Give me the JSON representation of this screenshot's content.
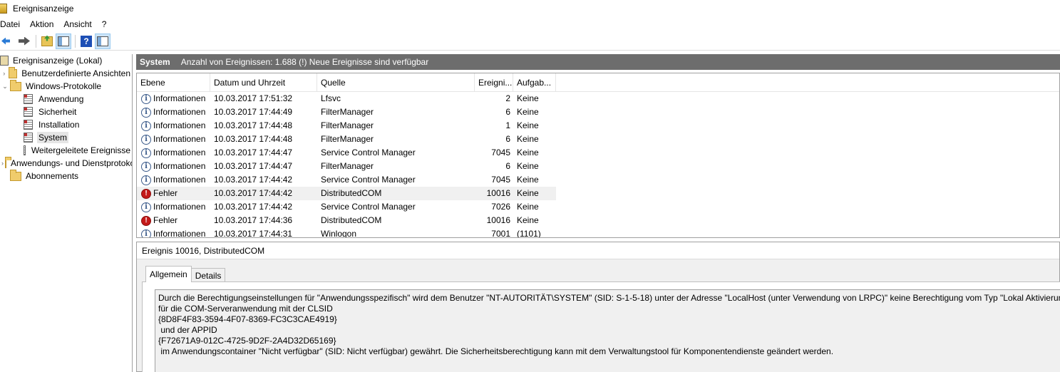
{
  "window": {
    "title": "Ereignisanzeige"
  },
  "menu": [
    "Datei",
    "Aktion",
    "Ansicht",
    "?"
  ],
  "toolbar": {
    "buttons": [
      "back-icon",
      "forward-icon",
      "up-folder-icon",
      "show-hide-pane-icon",
      "help-icon",
      "action-pane-icon"
    ]
  },
  "tree": [
    {
      "label": "Ereignisanzeige (Lokal)",
      "level": 0,
      "icon": "event-viewer-icon",
      "expander": ""
    },
    {
      "label": "Benutzerdefinierte Ansichten",
      "level": 1,
      "icon": "folder-icon",
      "expander": "›"
    },
    {
      "label": "Windows-Protokolle",
      "level": 1,
      "icon": "folder-icon",
      "expander": "⌄"
    },
    {
      "label": "Anwendung",
      "level": 2,
      "icon": "log-icon"
    },
    {
      "label": "Sicherheit",
      "level": 2,
      "icon": "log-icon"
    },
    {
      "label": "Installation",
      "level": 2,
      "icon": "log-icon"
    },
    {
      "label": "System",
      "level": 2,
      "icon": "log-icon",
      "selected": true
    },
    {
      "label": "Weitergeleitete Ereignisse",
      "level": 2,
      "icon": "log-icon-plain"
    },
    {
      "label": "Anwendungs- und Dienstprotokolle",
      "level": 1,
      "icon": "folder-icon",
      "expander": "›"
    },
    {
      "label": "Abonnements",
      "level": 1,
      "icon": "folder-icon",
      "expander": ""
    }
  ],
  "header": {
    "log_name": "System",
    "count_text": "Anzahl von Ereignissen: 1.688 (!) Neue Ereignisse sind verfügbar"
  },
  "columns": [
    "Ebene",
    "Datum und Uhrzeit",
    "Quelle",
    "Ereigni...",
    "Aufgab..."
  ],
  "events": [
    {
      "level": "Informationen",
      "type": "info",
      "date": "10.03.2017 17:51:32",
      "source": "Lfsvc",
      "id": "2",
      "task": "Keine"
    },
    {
      "level": "Informationen",
      "type": "info",
      "date": "10.03.2017 17:44:49",
      "source": "FilterManager",
      "id": "6",
      "task": "Keine"
    },
    {
      "level": "Informationen",
      "type": "info",
      "date": "10.03.2017 17:44:48",
      "source": "FilterManager",
      "id": "1",
      "task": "Keine"
    },
    {
      "level": "Informationen",
      "type": "info",
      "date": "10.03.2017 17:44:48",
      "source": "FilterManager",
      "id": "6",
      "task": "Keine"
    },
    {
      "level": "Informationen",
      "type": "info",
      "date": "10.03.2017 17:44:47",
      "source": "Service Control Manager",
      "id": "7045",
      "task": "Keine"
    },
    {
      "level": "Informationen",
      "type": "info",
      "date": "10.03.2017 17:44:47",
      "source": "FilterManager",
      "id": "6",
      "task": "Keine"
    },
    {
      "level": "Informationen",
      "type": "info",
      "date": "10.03.2017 17:44:42",
      "source": "Service Control Manager",
      "id": "7045",
      "task": "Keine"
    },
    {
      "level": "Fehler",
      "type": "error",
      "date": "10.03.2017 17:44:42",
      "source": "DistributedCOM",
      "id": "10016",
      "task": "Keine",
      "selected": true
    },
    {
      "level": "Informationen",
      "type": "info",
      "date": "10.03.2017 17:44:42",
      "source": "Service Control Manager",
      "id": "7026",
      "task": "Keine"
    },
    {
      "level": "Fehler",
      "type": "error",
      "date": "10.03.2017 17:44:36",
      "source": "DistributedCOM",
      "id": "10016",
      "task": "Keine"
    },
    {
      "level": "Informationen",
      "type": "info",
      "date": "10.03.2017 17:44:31",
      "source": "Winlogon",
      "id": "7001",
      "task": "(1101)"
    }
  ],
  "detail": {
    "title": "Ereignis 10016, DistributedCOM",
    "tabs": [
      "Allgemein",
      "Details"
    ],
    "message_lines": [
      "Durch die Berechtigungseinstellungen für \"Anwendungsspezifisch\" wird dem Benutzer \"NT-AUTORITÄT\\SYSTEM\" (SID: S-1-5-18) unter der Adresse \"LocalHost (unter Verwendung von LRPC)\" keine Berechtigung vom Typ \"Lokal Aktivierung\"",
      "für die COM-Serveranwendung mit der CLSID",
      "{8D8F4F83-3594-4F07-8369-FC3C3CAE4919}",
      " und der APPID",
      "{F72671A9-012C-4725-9D2F-2A4D32D65169}",
      " im Anwendungscontainer \"Nicht verfügbar\" (SID: Nicht verfügbar) gewährt. Die Sicherheitsberechtigung kann mit dem Verwaltungstool für Komponentendienste geändert werden."
    ]
  }
}
